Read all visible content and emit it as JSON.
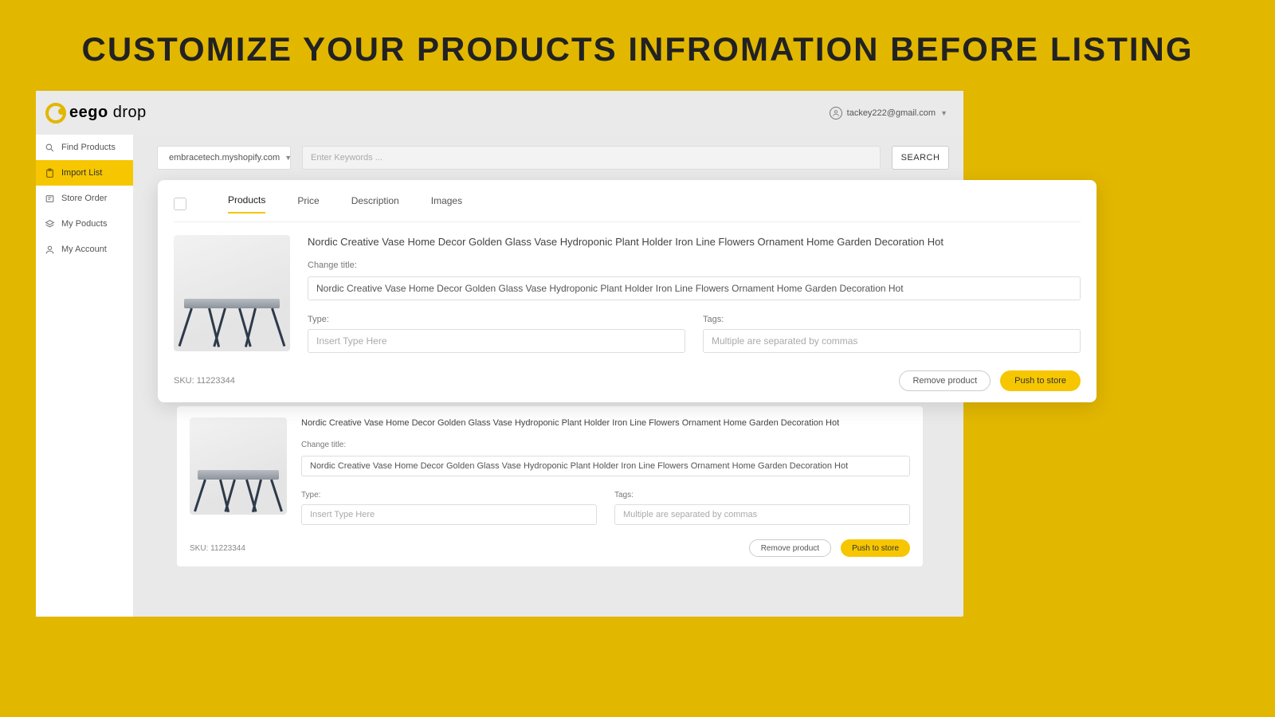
{
  "hero": {
    "title": "CUSTOMIZE YOUR PRODUCTS INFROMATION BEFORE LISTING"
  },
  "header": {
    "logo_part1": "eego",
    "logo_part2": " drop",
    "user_email": "tackey222@gmail.com"
  },
  "sidebar": {
    "items": [
      {
        "label": "Find Products"
      },
      {
        "label": "Import List"
      },
      {
        "label": "Store Order"
      },
      {
        "label": "My Poducts"
      },
      {
        "label": "My Account"
      }
    ]
  },
  "toolbar": {
    "store": "embracetech.myshopify.com",
    "search_placeholder": "Enter Keywords ...",
    "search_label": "SEARCH"
  },
  "tabs": [
    "Products",
    "Price",
    "Description",
    "Images"
  ],
  "labels": {
    "change_title": "Change title:",
    "type": "Type:",
    "tags": "Tags:",
    "type_placeholder": "Insert Type Here",
    "tags_placeholder": "Multiple are separated by commas",
    "sku_prefix": "SKU:",
    "remove_product": "Remove product",
    "push_to_store": "Push to store"
  },
  "products": [
    {
      "title": "Nordic Creative Vase Home Decor Golden Glass Vase Hydroponic Plant Holder Iron Line Flowers Ornament Home Garden Decoration Hot",
      "title_value": "Nordic Creative Vase Home Decor Golden Glass Vase Hydroponic Plant Holder Iron Line Flowers Ornament Home Garden Decoration Hot",
      "sku": "11223344"
    },
    {
      "title": "Nordic Creative Vase Home Decor Golden Glass Vase Hydroponic Plant Holder Iron Line Flowers Ornament Home Garden Decoration Hot",
      "title_value": "Nordic Creative Vase Home Decor Golden Glass Vase Hydroponic Plant Holder Iron Line Flowers Ornament Home Garden Decoration Hot",
      "sku": "11223344"
    }
  ],
  "colors": {
    "brand_yellow": "#e2b700",
    "accent_yellow": "#f6c600"
  }
}
